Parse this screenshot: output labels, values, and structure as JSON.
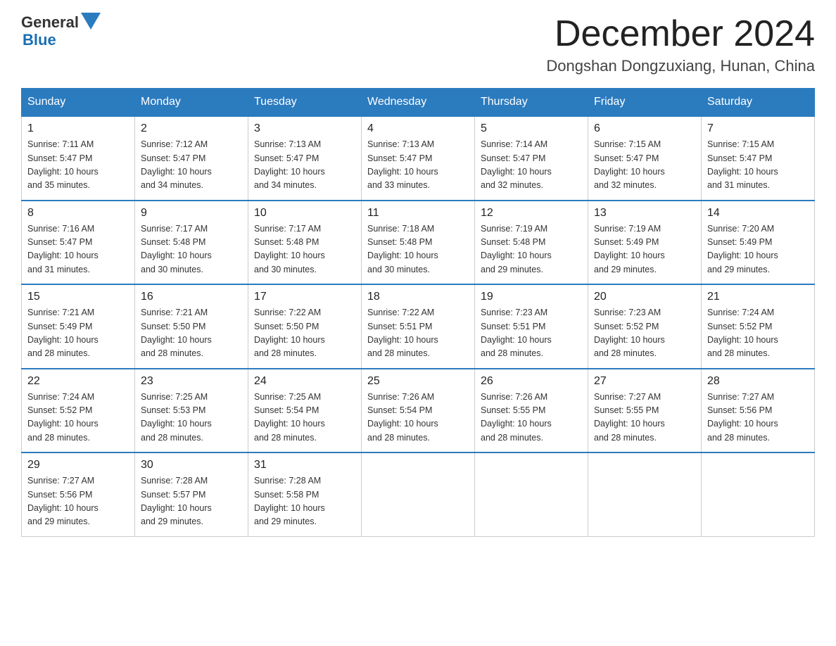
{
  "header": {
    "logo_general": "General",
    "logo_blue": "Blue",
    "month_title": "December 2024",
    "location": "Dongshan Dongzuxiang, Hunan, China"
  },
  "days_of_week": [
    "Sunday",
    "Monday",
    "Tuesday",
    "Wednesday",
    "Thursday",
    "Friday",
    "Saturday"
  ],
  "weeks": [
    [
      {
        "day": "1",
        "sunrise": "7:11 AM",
        "sunset": "5:47 PM",
        "daylight": "10 hours and 35 minutes."
      },
      {
        "day": "2",
        "sunrise": "7:12 AM",
        "sunset": "5:47 PM",
        "daylight": "10 hours and 34 minutes."
      },
      {
        "day": "3",
        "sunrise": "7:13 AM",
        "sunset": "5:47 PM",
        "daylight": "10 hours and 34 minutes."
      },
      {
        "day": "4",
        "sunrise": "7:13 AM",
        "sunset": "5:47 PM",
        "daylight": "10 hours and 33 minutes."
      },
      {
        "day": "5",
        "sunrise": "7:14 AM",
        "sunset": "5:47 PM",
        "daylight": "10 hours and 32 minutes."
      },
      {
        "day": "6",
        "sunrise": "7:15 AM",
        "sunset": "5:47 PM",
        "daylight": "10 hours and 32 minutes."
      },
      {
        "day": "7",
        "sunrise": "7:15 AM",
        "sunset": "5:47 PM",
        "daylight": "10 hours and 31 minutes."
      }
    ],
    [
      {
        "day": "8",
        "sunrise": "7:16 AM",
        "sunset": "5:47 PM",
        "daylight": "10 hours and 31 minutes."
      },
      {
        "day": "9",
        "sunrise": "7:17 AM",
        "sunset": "5:48 PM",
        "daylight": "10 hours and 30 minutes."
      },
      {
        "day": "10",
        "sunrise": "7:17 AM",
        "sunset": "5:48 PM",
        "daylight": "10 hours and 30 minutes."
      },
      {
        "day": "11",
        "sunrise": "7:18 AM",
        "sunset": "5:48 PM",
        "daylight": "10 hours and 30 minutes."
      },
      {
        "day": "12",
        "sunrise": "7:19 AM",
        "sunset": "5:48 PM",
        "daylight": "10 hours and 29 minutes."
      },
      {
        "day": "13",
        "sunrise": "7:19 AM",
        "sunset": "5:49 PM",
        "daylight": "10 hours and 29 minutes."
      },
      {
        "day": "14",
        "sunrise": "7:20 AM",
        "sunset": "5:49 PM",
        "daylight": "10 hours and 29 minutes."
      }
    ],
    [
      {
        "day": "15",
        "sunrise": "7:21 AM",
        "sunset": "5:49 PM",
        "daylight": "10 hours and 28 minutes."
      },
      {
        "day": "16",
        "sunrise": "7:21 AM",
        "sunset": "5:50 PM",
        "daylight": "10 hours and 28 minutes."
      },
      {
        "day": "17",
        "sunrise": "7:22 AM",
        "sunset": "5:50 PM",
        "daylight": "10 hours and 28 minutes."
      },
      {
        "day": "18",
        "sunrise": "7:22 AM",
        "sunset": "5:51 PM",
        "daylight": "10 hours and 28 minutes."
      },
      {
        "day": "19",
        "sunrise": "7:23 AM",
        "sunset": "5:51 PM",
        "daylight": "10 hours and 28 minutes."
      },
      {
        "day": "20",
        "sunrise": "7:23 AM",
        "sunset": "5:52 PM",
        "daylight": "10 hours and 28 minutes."
      },
      {
        "day": "21",
        "sunrise": "7:24 AM",
        "sunset": "5:52 PM",
        "daylight": "10 hours and 28 minutes."
      }
    ],
    [
      {
        "day": "22",
        "sunrise": "7:24 AM",
        "sunset": "5:52 PM",
        "daylight": "10 hours and 28 minutes."
      },
      {
        "day": "23",
        "sunrise": "7:25 AM",
        "sunset": "5:53 PM",
        "daylight": "10 hours and 28 minutes."
      },
      {
        "day": "24",
        "sunrise": "7:25 AM",
        "sunset": "5:54 PM",
        "daylight": "10 hours and 28 minutes."
      },
      {
        "day": "25",
        "sunrise": "7:26 AM",
        "sunset": "5:54 PM",
        "daylight": "10 hours and 28 minutes."
      },
      {
        "day": "26",
        "sunrise": "7:26 AM",
        "sunset": "5:55 PM",
        "daylight": "10 hours and 28 minutes."
      },
      {
        "day": "27",
        "sunrise": "7:27 AM",
        "sunset": "5:55 PM",
        "daylight": "10 hours and 28 minutes."
      },
      {
        "day": "28",
        "sunrise": "7:27 AM",
        "sunset": "5:56 PM",
        "daylight": "10 hours and 28 minutes."
      }
    ],
    [
      {
        "day": "29",
        "sunrise": "7:27 AM",
        "sunset": "5:56 PM",
        "daylight": "10 hours and 29 minutes."
      },
      {
        "day": "30",
        "sunrise": "7:28 AM",
        "sunset": "5:57 PM",
        "daylight": "10 hours and 29 minutes."
      },
      {
        "day": "31",
        "sunrise": "7:28 AM",
        "sunset": "5:58 PM",
        "daylight": "10 hours and 29 minutes."
      },
      null,
      null,
      null,
      null
    ]
  ],
  "labels": {
    "sunrise": "Sunrise:",
    "sunset": "Sunset:",
    "daylight": "Daylight:"
  }
}
